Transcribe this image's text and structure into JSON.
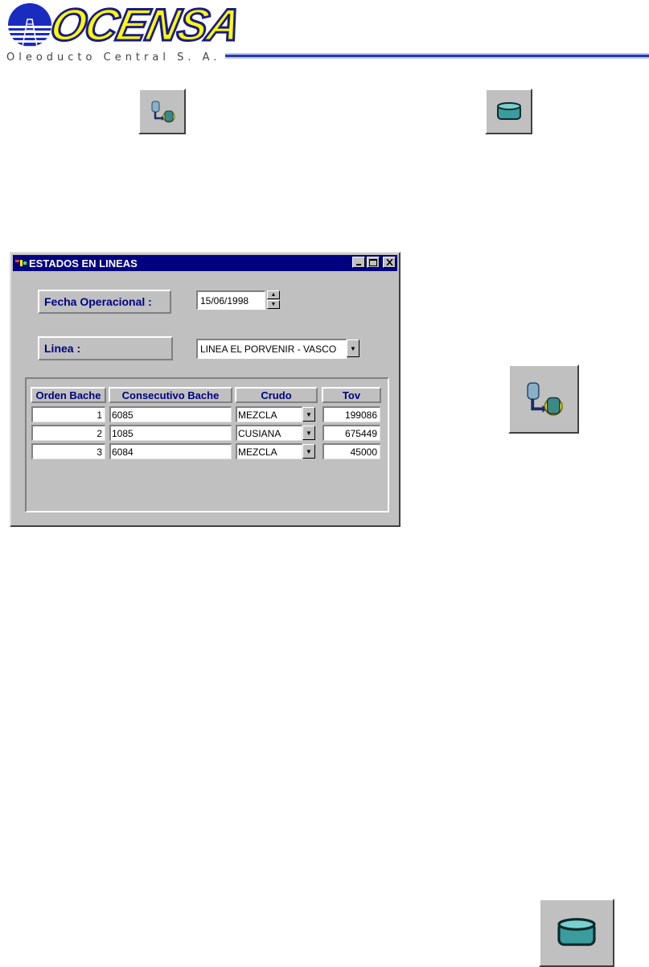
{
  "logo": {
    "name": "OCENSA",
    "subtitle": "Oleoducto Central S. A."
  },
  "colors": {
    "titlebar": "#000080",
    "label_text": "#000080",
    "face": "#c0c0c0",
    "logo_yellow": "#ffff00",
    "logo_blue": "#1a1a8c"
  },
  "icons": {
    "top_left": "database-connect-icon",
    "top_right": "database-cylinder-icon",
    "side": "database-connect-icon",
    "bottom_right": "database-cylinder-icon"
  },
  "window": {
    "title": "ESTADOS EN LINEAS",
    "fecha_label": "Fecha Operacional :",
    "fecha_value": "15/06/1998",
    "linea_label": "Linea :",
    "linea_value": "LINEA  EL PORVENIR - VASCO",
    "table": {
      "headers": [
        "Orden Bache",
        "Consecutivo Bache",
        "Crudo",
        "Tov"
      ],
      "rows": [
        {
          "orden": "1",
          "consecutivo": "6085",
          "crudo": "MEZCLA",
          "tov": "199086"
        },
        {
          "orden": "2",
          "consecutivo": "1085",
          "crudo": "CUSIANA",
          "tov": "675449"
        },
        {
          "orden": "3",
          "consecutivo": "6084",
          "crudo": "MEZCLA",
          "tov": "45000"
        }
      ]
    }
  }
}
